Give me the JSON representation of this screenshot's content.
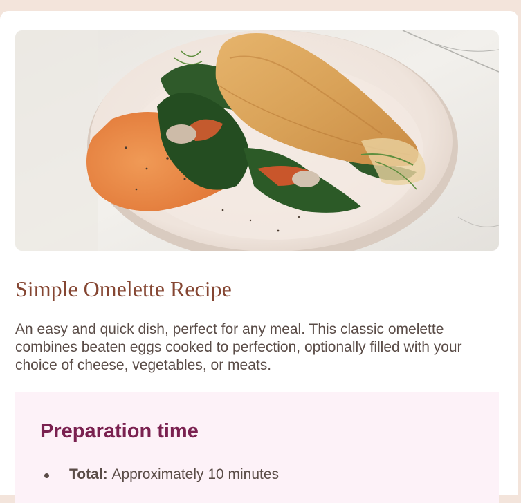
{
  "recipe": {
    "title": "Simple Omelette Recipe",
    "description": "An easy and quick dish, perfect for any meal. This classic omelette combines beaten eggs cooked to perfection, optionally filled with your choice of cheese, vegetables, or meats."
  },
  "preparation": {
    "title": "Preparation time",
    "items": [
      {
        "label": "Total:",
        "value": "Approximately 10 minutes"
      }
    ]
  },
  "colors": {
    "page_background": "#f3e4db",
    "card_background": "#ffffff",
    "title_color": "#854632",
    "text_color": "#5a4c47",
    "prep_background": "#fdf2f8",
    "prep_title_color": "#7a2150"
  },
  "image": {
    "subject": "omelette-on-plate-photo"
  }
}
